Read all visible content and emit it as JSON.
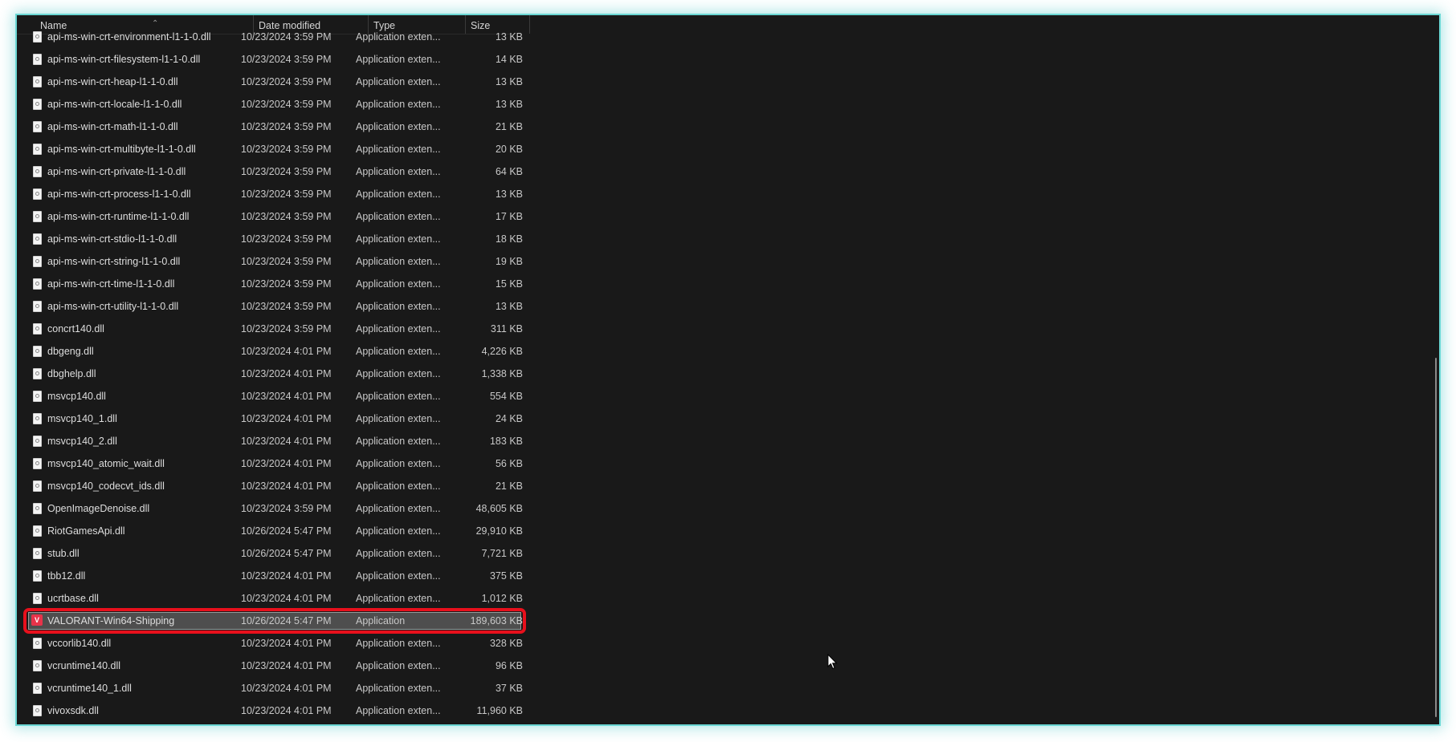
{
  "columns": {
    "name": "Name",
    "date": "Date modified",
    "type": "Type",
    "size": "Size"
  },
  "icons": {
    "file": "dll-file-icon",
    "app": "valorant-app-icon",
    "sort": "sort-up-icon"
  },
  "files": [
    {
      "name": "api-ms-win-crt-environment-l1-1-0.dll",
      "date": "10/23/2024 3:59 PM",
      "type": "Application exten...",
      "size": "13 KB"
    },
    {
      "name": "api-ms-win-crt-filesystem-l1-1-0.dll",
      "date": "10/23/2024 3:59 PM",
      "type": "Application exten...",
      "size": "14 KB"
    },
    {
      "name": "api-ms-win-crt-heap-l1-1-0.dll",
      "date": "10/23/2024 3:59 PM",
      "type": "Application exten...",
      "size": "13 KB"
    },
    {
      "name": "api-ms-win-crt-locale-l1-1-0.dll",
      "date": "10/23/2024 3:59 PM",
      "type": "Application exten...",
      "size": "13 KB"
    },
    {
      "name": "api-ms-win-crt-math-l1-1-0.dll",
      "date": "10/23/2024 3:59 PM",
      "type": "Application exten...",
      "size": "21 KB"
    },
    {
      "name": "api-ms-win-crt-multibyte-l1-1-0.dll",
      "date": "10/23/2024 3:59 PM",
      "type": "Application exten...",
      "size": "20 KB"
    },
    {
      "name": "api-ms-win-crt-private-l1-1-0.dll",
      "date": "10/23/2024 3:59 PM",
      "type": "Application exten...",
      "size": "64 KB"
    },
    {
      "name": "api-ms-win-crt-process-l1-1-0.dll",
      "date": "10/23/2024 3:59 PM",
      "type": "Application exten...",
      "size": "13 KB"
    },
    {
      "name": "api-ms-win-crt-runtime-l1-1-0.dll",
      "date": "10/23/2024 3:59 PM",
      "type": "Application exten...",
      "size": "17 KB"
    },
    {
      "name": "api-ms-win-crt-stdio-l1-1-0.dll",
      "date": "10/23/2024 3:59 PM",
      "type": "Application exten...",
      "size": "18 KB"
    },
    {
      "name": "api-ms-win-crt-string-l1-1-0.dll",
      "date": "10/23/2024 3:59 PM",
      "type": "Application exten...",
      "size": "19 KB"
    },
    {
      "name": "api-ms-win-crt-time-l1-1-0.dll",
      "date": "10/23/2024 3:59 PM",
      "type": "Application exten...",
      "size": "15 KB"
    },
    {
      "name": "api-ms-win-crt-utility-l1-1-0.dll",
      "date": "10/23/2024 3:59 PM",
      "type": "Application exten...",
      "size": "13 KB"
    },
    {
      "name": "concrt140.dll",
      "date": "10/23/2024 3:59 PM",
      "type": "Application exten...",
      "size": "311 KB"
    },
    {
      "name": "dbgeng.dll",
      "date": "10/23/2024 4:01 PM",
      "type": "Application exten...",
      "size": "4,226 KB"
    },
    {
      "name": "dbghelp.dll",
      "date": "10/23/2024 4:01 PM",
      "type": "Application exten...",
      "size": "1,338 KB"
    },
    {
      "name": "msvcp140.dll",
      "date": "10/23/2024 4:01 PM",
      "type": "Application exten...",
      "size": "554 KB"
    },
    {
      "name": "msvcp140_1.dll",
      "date": "10/23/2024 4:01 PM",
      "type": "Application exten...",
      "size": "24 KB"
    },
    {
      "name": "msvcp140_2.dll",
      "date": "10/23/2024 4:01 PM",
      "type": "Application exten...",
      "size": "183 KB"
    },
    {
      "name": "msvcp140_atomic_wait.dll",
      "date": "10/23/2024 4:01 PM",
      "type": "Application exten...",
      "size": "56 KB"
    },
    {
      "name": "msvcp140_codecvt_ids.dll",
      "date": "10/23/2024 4:01 PM",
      "type": "Application exten...",
      "size": "21 KB"
    },
    {
      "name": "OpenImageDenoise.dll",
      "date": "10/23/2024 3:59 PM",
      "type": "Application exten...",
      "size": "48,605 KB"
    },
    {
      "name": "RiotGamesApi.dll",
      "date": "10/26/2024 5:47 PM",
      "type": "Application exten...",
      "size": "29,910 KB"
    },
    {
      "name": "stub.dll",
      "date": "10/26/2024 5:47 PM",
      "type": "Application exten...",
      "size": "7,721 KB"
    },
    {
      "name": "tbb12.dll",
      "date": "10/23/2024 4:01 PM",
      "type": "Application exten...",
      "size": "375 KB"
    },
    {
      "name": "ucrtbase.dll",
      "date": "10/23/2024 4:01 PM",
      "type": "Application exten...",
      "size": "1,012 KB"
    },
    {
      "name": "VALORANT-Win64-Shipping",
      "date": "10/26/2024 5:47 PM",
      "type": "Application",
      "size": "189,603 KB",
      "selected": true,
      "icon": "app"
    },
    {
      "name": "vccorlib140.dll",
      "date": "10/23/2024 4:01 PM",
      "type": "Application exten...",
      "size": "328 KB"
    },
    {
      "name": "vcruntime140.dll",
      "date": "10/23/2024 4:01 PM",
      "type": "Application exten...",
      "size": "96 KB"
    },
    {
      "name": "vcruntime140_1.dll",
      "date": "10/23/2024 4:01 PM",
      "type": "Application exten...",
      "size": "37 KB"
    },
    {
      "name": "vivoxsdk.dll",
      "date": "10/23/2024 4:01 PM",
      "type": "Application exten...",
      "size": "11,960 KB"
    }
  ],
  "colors": {
    "background": "#191919",
    "window_glow": "#6ad7d4",
    "highlight_ring": "#e8101c",
    "selection": "#4e4e4e"
  }
}
